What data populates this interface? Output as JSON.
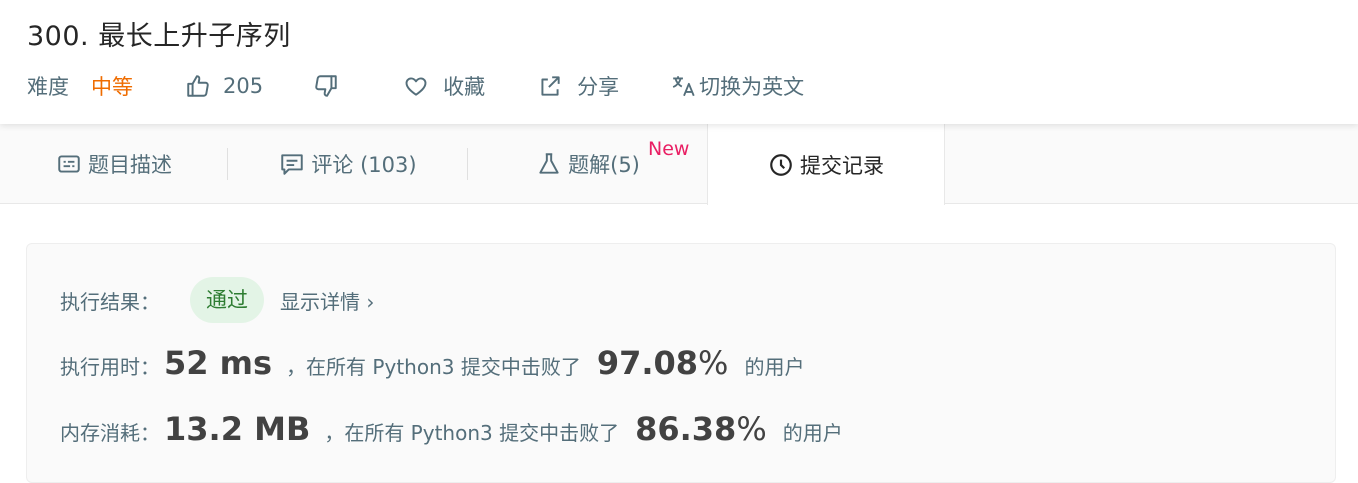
{
  "problem": {
    "title": "300. 最长上升子序列",
    "difficulty_label": "难度",
    "difficulty_value": "中等",
    "likes": "205",
    "favorite_label": "收藏",
    "share_label": "分享",
    "translate_label": "切换为英文"
  },
  "tabs": [
    {
      "label": "题目描述",
      "icon": "description-icon"
    },
    {
      "label": "评论 (103)",
      "icon": "comment-icon"
    },
    {
      "label": "题解(5)",
      "icon": "flask-icon",
      "badge": "New"
    },
    {
      "label": "提交记录",
      "icon": "clock-icon",
      "active": true
    }
  ],
  "result": {
    "status_label": "执行结果：",
    "status_value": "通过",
    "detail_link": "显示详情 ›",
    "runtime_label": "执行用时：",
    "runtime_value": "52 ms",
    "runtime_mid": "，在所有 Python3 提交中击败了",
    "runtime_pct_num": "97.08",
    "runtime_pct_sym": "%",
    "runtime_suffix": "的用户",
    "memory_label": "内存消耗：",
    "memory_value": "13.2 MB",
    "memory_mid": "，在所有 Python3 提交中击败了",
    "memory_pct_num": "86.38",
    "memory_pct_sym": "%",
    "memory_suffix": "的用户"
  },
  "colors": {
    "difficulty": "#ef6c00",
    "new_badge": "#e91e63",
    "status_bg": "#e3f4e6",
    "status_text": "#2e7d32"
  }
}
